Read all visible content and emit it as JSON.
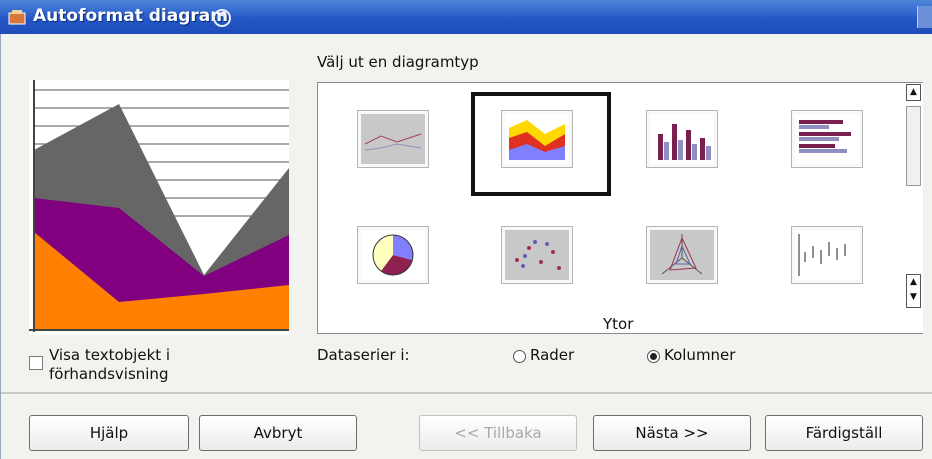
{
  "window": {
    "title": "Autoformat diagram"
  },
  "left": {
    "checkbox_label_line1": "Visa textobjekt i",
    "checkbox_label_line2": "förhandsvisning",
    "checkbox_checked": false
  },
  "gallery": {
    "heading": "Välj ut en diagramtyp",
    "selected_type": "Ytor",
    "tiles": [
      {
        "icon": "line-chart-icon"
      },
      {
        "icon": "area-chart-icon",
        "selected": true
      },
      {
        "icon": "column-chart-icon"
      },
      {
        "icon": "bar-chart-icon"
      },
      {
        "icon": "pie-chart-icon"
      },
      {
        "icon": "xy-scatter-chart-icon"
      },
      {
        "icon": "net-chart-icon"
      },
      {
        "icon": "stock-chart-icon"
      }
    ]
  },
  "data_series": {
    "label": "Dataserier i:",
    "options": [
      {
        "label": "Rader",
        "selected": false
      },
      {
        "label": "Kolumner",
        "selected": true
      }
    ]
  },
  "buttons": {
    "help": "Hjälp",
    "cancel": "Avbryt",
    "back": "<< Tillbaka",
    "next": "Nästa >>",
    "finish": "Färdigställ"
  },
  "colors": {
    "titlebar": "#2457c6",
    "area_orange": "#ff8000",
    "area_purple": "#800080",
    "area_gray": "#666666"
  }
}
